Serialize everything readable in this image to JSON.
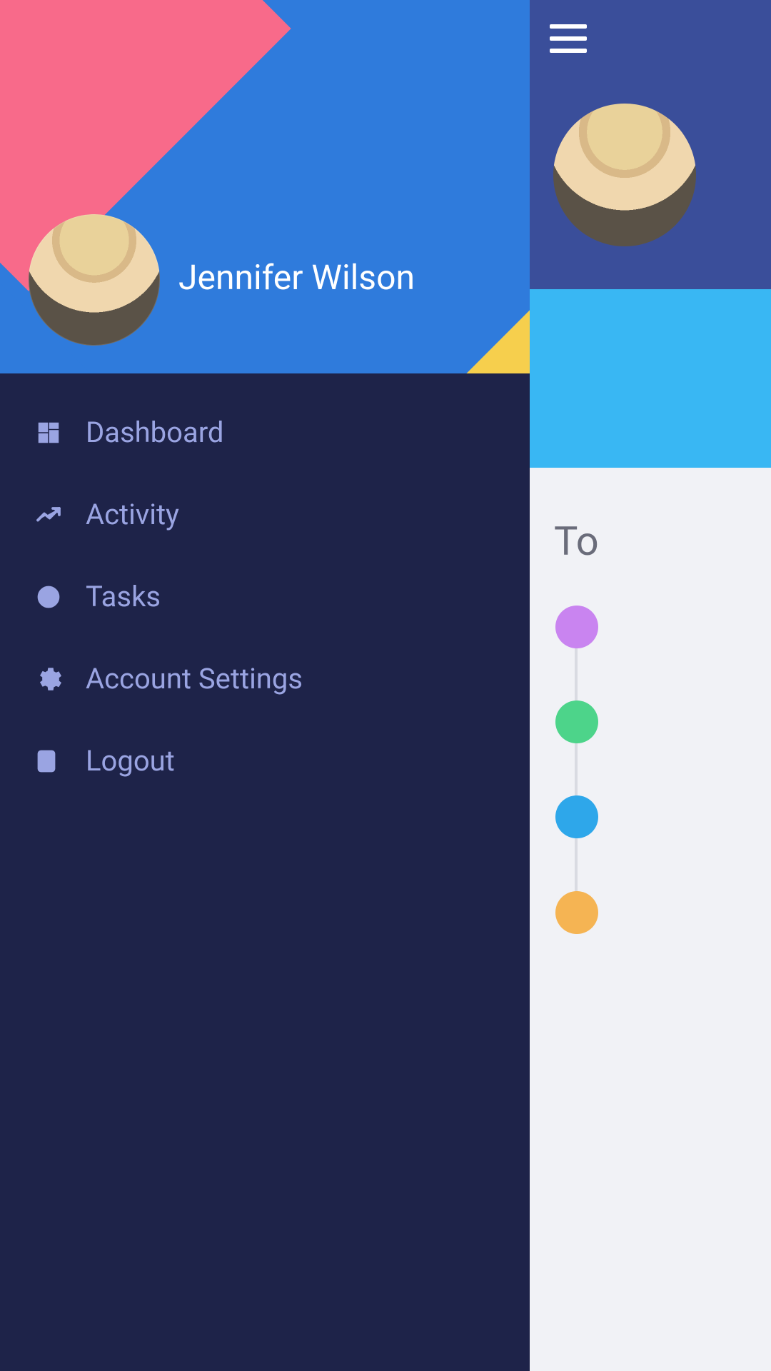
{
  "user": {
    "name": "Jennifer Wilson"
  },
  "menu": {
    "items": [
      {
        "icon": "dashboard-icon",
        "label": "Dashboard"
      },
      {
        "icon": "activity-icon",
        "label": "Activity"
      },
      {
        "icon": "clock-icon",
        "label": "Tasks"
      },
      {
        "icon": "gear-icon",
        "label": "Account Settings"
      },
      {
        "icon": "logout-icon",
        "label": "Logout"
      }
    ]
  },
  "main": {
    "section_title_partial": "To",
    "timeline_colors": [
      "#c984f0",
      "#4dd48a",
      "#2ea7ea",
      "#f5b453"
    ]
  }
}
